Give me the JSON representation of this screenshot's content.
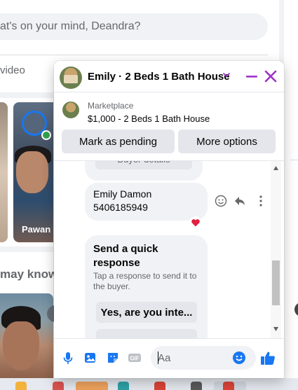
{
  "background": {
    "post_prompt": "at's on your mind, Deandra?",
    "live_video_label": "video",
    "story_name": "Pawan R",
    "people_you_may_know": "may know"
  },
  "chat": {
    "title": "Emily · 2 Beds 1 Bath House",
    "marketplace_label": "Marketplace",
    "listing": "$1,000 - 2 Beds 1 Bath House",
    "mark_pending_label": "Mark as pending",
    "more_options_label": "More options",
    "previous_button_fragment": "Buyer details",
    "message": {
      "line1": "Emily Damon",
      "line2": "5406185949",
      "reaction": "heart"
    },
    "quick_response": {
      "title": "Send a quick response",
      "subtitle": "Tap a response to send it to the buyer.",
      "option1": "Yes, are you inte..."
    },
    "composer": {
      "placeholder": "Aa"
    }
  },
  "colors": {
    "accent": "#1877f2",
    "header_controls": "#a033c8",
    "bubble": "#f0f2f5",
    "heart": "#e41e3f"
  }
}
